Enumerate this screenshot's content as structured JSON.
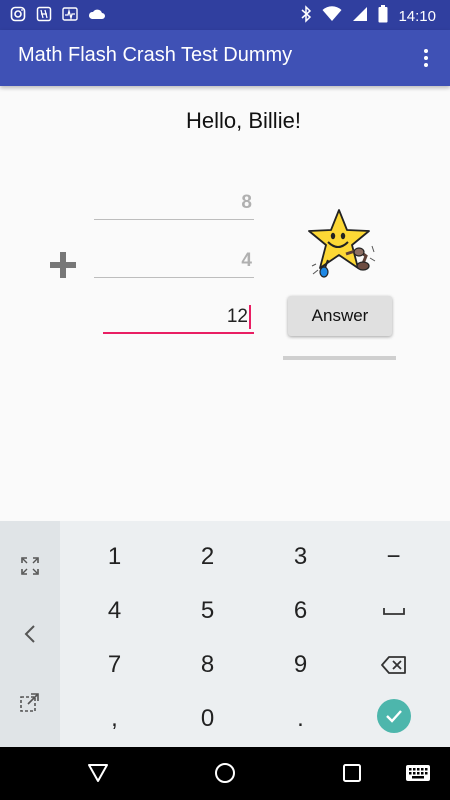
{
  "status_bar": {
    "time": "14:10",
    "left_icons": [
      "instagram-icon",
      "app-icon",
      "activity-icon",
      "cloud-icon"
    ],
    "right_icons": [
      "bluetooth-icon",
      "wifi-icon",
      "signal-icon",
      "battery-icon"
    ]
  },
  "app_bar": {
    "title": "Math Flash Crash Test Dummy",
    "menu_icon": "overflow-menu-icon"
  },
  "main": {
    "greeting": "Hello, Billie!",
    "operand1": "8",
    "operand2": "4",
    "operator_icon": "plus-icon",
    "answer_value": "12",
    "answer_button_label": "Answer",
    "image": "star-mascot-icon"
  },
  "keyboard": {
    "rows": [
      [
        "1",
        "2",
        "3",
        "−"
      ],
      [
        "4",
        "5",
        "6",
        "space"
      ],
      [
        "7",
        "8",
        "9",
        "backspace"
      ],
      [
        ",",
        "0",
        ".",
        "enter"
      ]
    ],
    "labels": {
      "k1": "1",
      "k2": "2",
      "k3": "3",
      "kminus": "−",
      "k4": "4",
      "k5": "5",
      "k6": "6",
      "k7": "7",
      "k8": "8",
      "k9": "9",
      "kcomma": ",",
      "k0": "0",
      "kdot": "."
    },
    "side_icons": [
      "fullscreen-icon",
      "back-arrow-icon",
      "popout-icon"
    ],
    "accent_color": "#4db6ac"
  },
  "nav_bar": {
    "icons": [
      "back-triangle-icon",
      "home-circle-icon",
      "recents-square-icon",
      "keyboard-switch-icon"
    ]
  },
  "colors": {
    "status_bar": "#303f9f",
    "app_bar": "#3f51b5",
    "focus_underline": "#e91e63"
  }
}
